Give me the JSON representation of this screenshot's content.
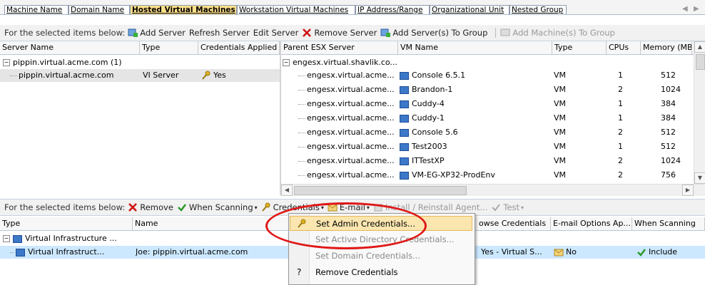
{
  "tabs": [
    "Machine Name",
    "Domain Name",
    "Hosted Virtual Machines",
    "Workstation Virtual Machines",
    "IP Address/Range",
    "Organizational Unit",
    "Nested Group"
  ],
  "tab_nav": {
    "prev": "◀",
    "next": "▶"
  },
  "top_toolbar": {
    "label": "For the selected items below:",
    "add_server": "Add Server",
    "refresh_server": "Refresh Server",
    "edit_server": "Edit Server",
    "remove_server": "Remove Server",
    "add_servers_to_group": "Add Server(s) To Group",
    "add_machines_to_group": "Add Machine(s) To Group"
  },
  "left_table": {
    "headers": [
      "Server Name",
      "Type",
      "Credentials Applied"
    ],
    "group_row": "pippin.virtual.acme.com (1)",
    "row": {
      "name": "pippin.virtual.acme.com",
      "type": "VI Server",
      "credentials": "Yes"
    }
  },
  "right_table": {
    "headers": [
      "Parent ESX Server",
      "VM Name",
      "Type",
      "CPUs",
      "Memory (MB"
    ],
    "group_row": "engesx.virtual.shavlik.co...",
    "rows": [
      {
        "parent": "engesx.virtual.acme...",
        "vm": "Console 6.5.1",
        "type": "VM",
        "cpus": "1",
        "memory": "512"
      },
      {
        "parent": "engesx.virtual.acme...",
        "vm": "Brandon-1",
        "type": "VM",
        "cpus": "2",
        "memory": "1024"
      },
      {
        "parent": "engesx.virtual.acme...",
        "vm": "Cuddy-4",
        "type": "VM",
        "cpus": "1",
        "memory": "384"
      },
      {
        "parent": "engesx.virtual.acme...",
        "vm": "Cuddy-1",
        "type": "VM",
        "cpus": "1",
        "memory": "384"
      },
      {
        "parent": "engesx.virtual.acme...",
        "vm": "Console 5.6",
        "type": "VM",
        "cpus": "2",
        "memory": "512"
      },
      {
        "parent": "engesx.virtual.acme...",
        "vm": "Test2003",
        "type": "VM",
        "cpus": "1",
        "memory": "512"
      },
      {
        "parent": "engesx.virtual.acme...",
        "vm": "ITTestXP",
        "type": "VM",
        "cpus": "2",
        "memory": "1024"
      },
      {
        "parent": "engesx.virtual.acme...",
        "vm": "VM-EG-XP32-ProdEnv",
        "type": "VM",
        "cpus": "2",
        "memory": "756"
      }
    ]
  },
  "bottom_toolbar": {
    "label": "For the selected items below:",
    "remove": "Remove",
    "when_scanning": "When Scanning",
    "credentials": "Credentials",
    "email": "E-mail",
    "install": "Install / Reinstall Agent...",
    "test": "Test"
  },
  "bottom_table": {
    "headers": [
      "Type",
      "Name",
      "owse Credentials",
      "E-mail Options Ap...",
      "When Scanning"
    ],
    "group_row": "Virtual Infrastructure ...",
    "row": {
      "type": "Virtual Infrastruct...",
      "name": "Joe: pippin.virtual.acme.com",
      "browse": "Yes - Virtual S...",
      "email": "No",
      "scanning": "Include"
    }
  },
  "credentials_menu": [
    "Set Admin Credentials...",
    "Set Active Directory Credentials...",
    "Set Domain Credentials...",
    "Remove Credentials"
  ],
  "colors": {
    "accent": "#ffe08a",
    "highlight_oval": "#e01818",
    "selection": "#cce8ff"
  }
}
